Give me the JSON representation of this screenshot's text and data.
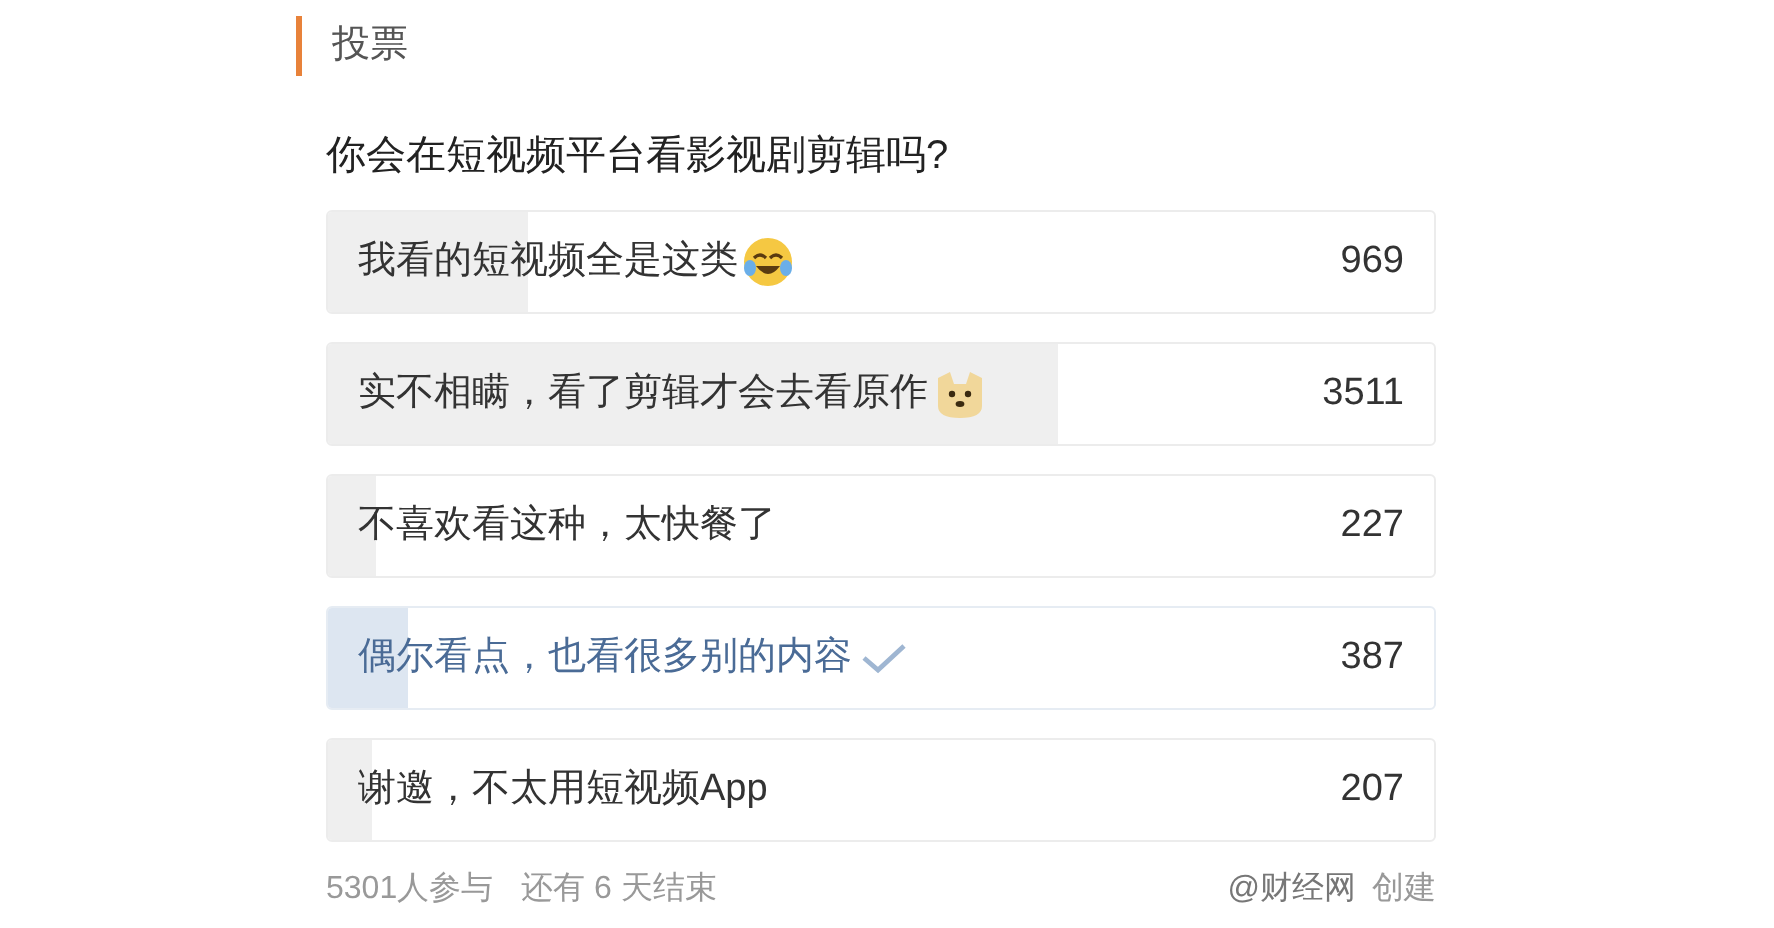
{
  "section_title": "投票",
  "question": "你会在短视频平台看影视剧剪辑吗?",
  "options": [
    {
      "label": "我看的短视频全是这类",
      "kind": "laughemoji",
      "count": "969",
      "level": 0.18,
      "selected": false
    },
    {
      "label": "实不相瞒，看了剪辑才会去看原作",
      "kind": "dogemoji",
      "count": "3511",
      "level": 0.66,
      "selected": false
    },
    {
      "label": "不喜欢看这种，太快餐了",
      "kind": "plain",
      "count": "227",
      "level": 0.043,
      "selected": false
    },
    {
      "label": "偶尔看点，也看很多别的内容",
      "kind": "plain",
      "count": "387",
      "level": 0.073,
      "selected": true
    },
    {
      "label": "谢邀，不太用短视频App",
      "kind": "plain",
      "count": "207",
      "level": 0.039,
      "selected": false
    }
  ],
  "footer": {
    "participants": "5301人参与",
    "remaining": "还有 6 天结束",
    "creator": "@财经网",
    "created": "创建"
  }
}
